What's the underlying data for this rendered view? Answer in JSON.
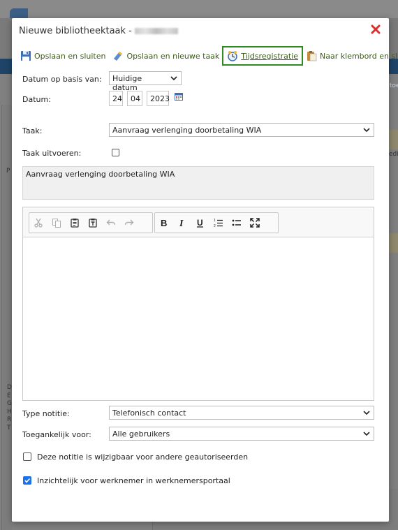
{
  "dialog": {
    "title": "Nieuwe bibliotheektaak -",
    "toolbar": {
      "save_close": "Opslaan en sluiten",
      "save_new": "Opslaan en nieuwe taak",
      "time_registration": "Tijdsregistratie",
      "clipboard_close": "Naar klembord en sluiten"
    },
    "form": {
      "date_basis_label": "Datum op basis van:",
      "date_basis_value": "Huidige datum",
      "date_label": "Datum:",
      "date_day": "24",
      "date_month": "04",
      "date_year": "2023",
      "task_label": "Taak:",
      "task_value": "Aanvraag verlenging doorbetaling WIA",
      "execute_label": "Taak uitvoeren:",
      "execute_checked": false,
      "description": "Aanvraag verlenging doorbetaling WIA",
      "note_type_label": "Type notitie:",
      "note_type_value": "Telefonisch contact",
      "access_label": "Toegankelijk voor:",
      "access_value": "Alle gebruikers",
      "editable_label": "Deze notitie is wijzigbaar voor andere geautoriseerden",
      "editable_checked": false,
      "visible_label": "Inzichtelijk voor werknemer in werknemersportaal",
      "visible_checked": true
    },
    "editor_icons": [
      "cut-icon",
      "copy-icon",
      "paste-icon",
      "paste-text-icon",
      "undo-icon",
      "redo-icon",
      "bold-icon",
      "italic-icon",
      "underline-icon",
      "numbered-list-icon",
      "bullet-list-icon",
      "maximize-icon"
    ]
  },
  "background": {
    "fragments": [
      "toe",
      "edis",
      "P",
      "D",
      "E",
      "G",
      "H",
      "R",
      "T"
    ]
  },
  "colors": {
    "link_green": "#3a5a1a",
    "highlight_border": "#2e8b1f",
    "close_red": "#d9302c",
    "checkbox_blue": "#1a73e8"
  }
}
